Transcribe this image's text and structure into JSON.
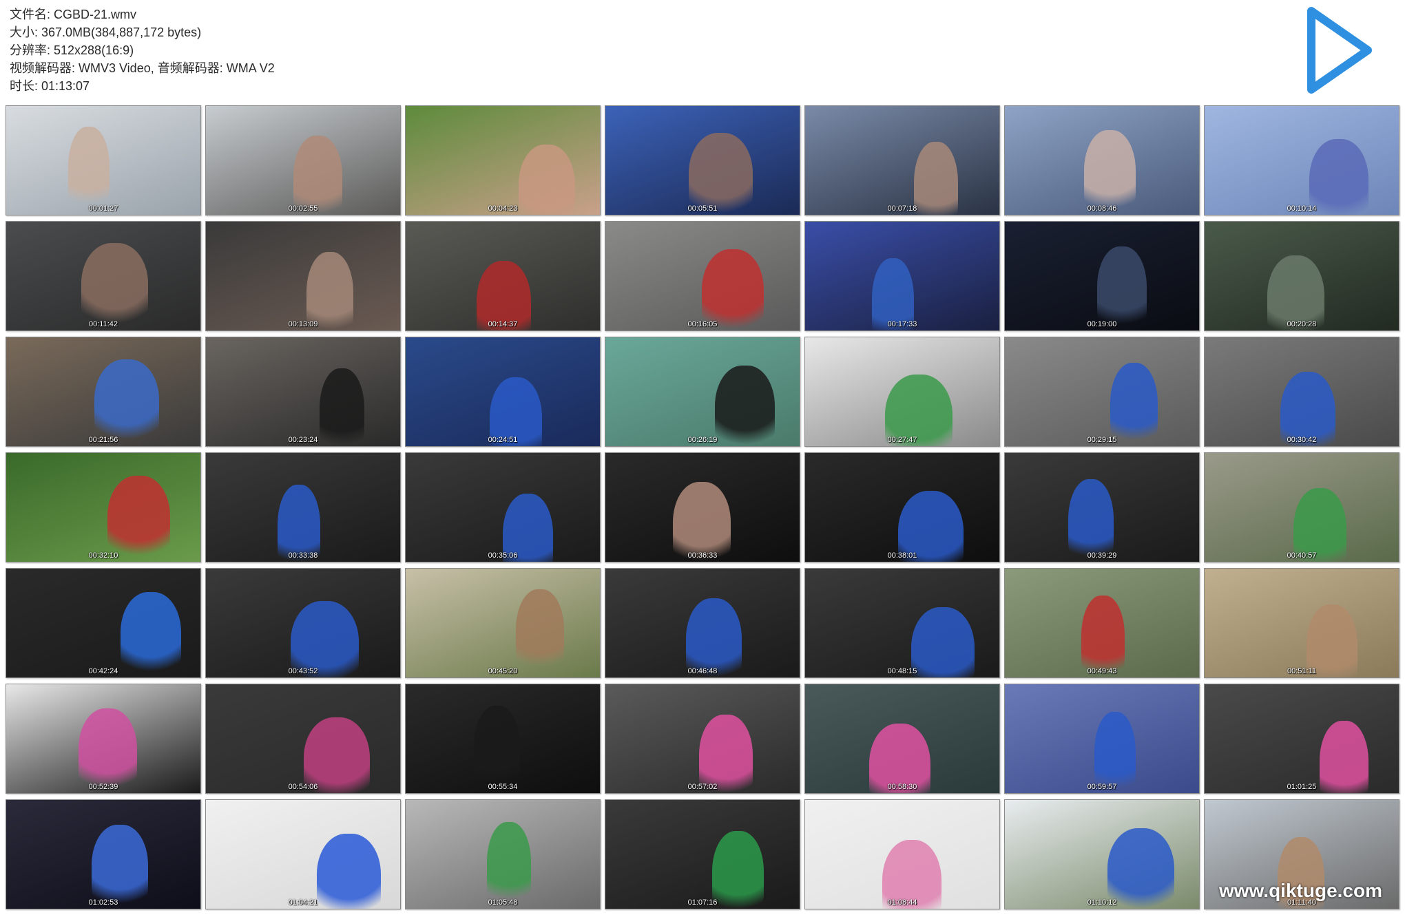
{
  "metadata": {
    "lines": [
      "文件名: CGBD-21.wmv",
      "大小: 367.0MB(384,887,172 bytes)",
      "分辨率: 512x288(16:9)",
      "视频解码器: WMV3 Video, 音频解码器: WMA V2",
      "时长: 01:13:07"
    ]
  },
  "icons": {
    "play": "play-icon",
    "play_color": "#2f8fe0"
  },
  "thumbnails": [
    {
      "ts": "00:01:27",
      "bg": [
        "#d8dce0",
        "#9aa3ab"
      ],
      "fig": "#c9b0a0"
    },
    {
      "ts": "00:02:55",
      "bg": [
        "#c7ccd0",
        "#5b5a58"
      ],
      "fig": "#b08a78"
    },
    {
      "ts": "00:04:23",
      "bg": [
        "#5d8b3c",
        "#c9a08a"
      ],
      "fig": "#c89880"
    },
    {
      "ts": "00:05:51",
      "bg": [
        "#3c62b8",
        "#1b2a55"
      ],
      "fig": "#8a6a60"
    },
    {
      "ts": "00:07:18",
      "bg": [
        "#7a8aa8",
        "#2a3344"
      ],
      "fig": "#a8897a"
    },
    {
      "ts": "00:08:46",
      "bg": [
        "#8ea3c6",
        "#4a5a7a"
      ],
      "fig": "#c8b0a8"
    },
    {
      "ts": "00:10:14",
      "bg": [
        "#9fb6e0",
        "#6d86b8"
      ],
      "fig": "#5a6ab8"
    },
    {
      "ts": "00:11:42",
      "bg": [
        "#4a4c4e",
        "#2a2a2a"
      ],
      "fig": "#8a6d60"
    },
    {
      "ts": "00:13:09",
      "bg": [
        "#3a3a3a",
        "#6a5a52"
      ],
      "fig": "#a48878"
    },
    {
      "ts": "00:14:37",
      "bg": [
        "#5a5a55",
        "#2e2e2c"
      ],
      "fig": "#b02a2a"
    },
    {
      "ts": "00:16:05",
      "bg": [
        "#8a8a88",
        "#5a5a5a"
      ],
      "fig": "#c03030"
    },
    {
      "ts": "00:17:33",
      "bg": [
        "#3a4ea8",
        "#1a2040"
      ],
      "fig": "#3060c0"
    },
    {
      "ts": "00:19:00",
      "bg": [
        "#1a2032",
        "#0a0c12"
      ],
      "fig": "#3a4a6a"
    },
    {
      "ts": "00:20:28",
      "bg": [
        "#4a5a4a",
        "#222a22"
      ],
      "fig": "#6a7a6a"
    },
    {
      "ts": "00:21:56",
      "bg": [
        "#7a6a5a",
        "#3a3a3a"
      ],
      "fig": "#3a6ac8"
    },
    {
      "ts": "00:23:24",
      "bg": [
        "#6a6560",
        "#2a2a2a"
      ],
      "fig": "#1a1a1a"
    },
    {
      "ts": "00:24:51",
      "bg": [
        "#2a4a8a",
        "#1a2a5a"
      ],
      "fig": "#2a5ac8"
    },
    {
      "ts": "00:26:19",
      "bg": [
        "#6aa89a",
        "#4a7a6a"
      ],
      "fig": "#1a1a1a"
    },
    {
      "ts": "00:27:47",
      "bg": [
        "#e8e8e8",
        "#8a8a8a"
      ],
      "fig": "#3a9a4a"
    },
    {
      "ts": "00:29:15",
      "bg": [
        "#8a8a8a",
        "#5a5a5a"
      ],
      "fig": "#2a5ac8"
    },
    {
      "ts": "00:30:42",
      "bg": [
        "#7a7a7a",
        "#4a4a4a"
      ],
      "fig": "#2a5ac8"
    },
    {
      "ts": "00:32:10",
      "bg": [
        "#3a6a2a",
        "#6a9a4a"
      ],
      "fig": "#c03030"
    },
    {
      "ts": "00:33:38",
      "bg": [
        "#3a3a3a",
        "#1a1a1a"
      ],
      "fig": "#2a5ac8"
    },
    {
      "ts": "00:35:06",
      "bg": [
        "#3a3a3a",
        "#1a1a1a"
      ],
      "fig": "#2a5ac8"
    },
    {
      "ts": "00:36:33",
      "bg": [
        "#2a2a2a",
        "#0e0e0e"
      ],
      "fig": "#b08a7a"
    },
    {
      "ts": "00:38:01",
      "bg": [
        "#2a2a2a",
        "#0e0e0e"
      ],
      "fig": "#2a5ac8"
    },
    {
      "ts": "00:39:29",
      "bg": [
        "#3a3a3a",
        "#1a1a1a"
      ],
      "fig": "#2a5ac8"
    },
    {
      "ts": "00:40:57",
      "bg": [
        "#9a9a8a",
        "#5a6a4a"
      ],
      "fig": "#3a9a4a"
    },
    {
      "ts": "00:42:24",
      "bg": [
        "#2a2a2a",
        "#1a1a1a"
      ],
      "fig": "#2a6ad8"
    },
    {
      "ts": "00:43:52",
      "bg": [
        "#3a3a3a",
        "#1a1a1a"
      ],
      "fig": "#2a5ac8"
    },
    {
      "ts": "00:45:20",
      "bg": [
        "#c8c0a8",
        "#6a7a4a"
      ],
      "fig": "#a07a5a"
    },
    {
      "ts": "00:46:48",
      "bg": [
        "#3a3a3a",
        "#1a1a1a"
      ],
      "fig": "#2a5ac8"
    },
    {
      "ts": "00:48:15",
      "bg": [
        "#3a3a3a",
        "#1a1a1a"
      ],
      "fig": "#2a5ac8"
    },
    {
      "ts": "00:49:43",
      "bg": [
        "#8a9a7a",
        "#5a6a4a"
      ],
      "fig": "#c03030"
    },
    {
      "ts": "00:51:11",
      "bg": [
        "#c0b090",
        "#8a7a5a"
      ],
      "fig": "#b08a6a"
    },
    {
      "ts": "00:52:39",
      "bg": [
        "#e8e8e8",
        "#1a1a1a"
      ],
      "fig": "#d050a0"
    },
    {
      "ts": "00:54:06",
      "bg": [
        "#3a3a3a",
        "#2a2a2a"
      ],
      "fig": "#c04080"
    },
    {
      "ts": "00:55:34",
      "bg": [
        "#2a2a2a",
        "#0e0e0e"
      ],
      "fig": "#1a1a1a"
    },
    {
      "ts": "00:57:02",
      "bg": [
        "#5a5a5a",
        "#2a2a2a"
      ],
      "fig": "#e050a0"
    },
    {
      "ts": "00:58:30",
      "bg": [
        "#4a5a5a",
        "#2a3a3a"
      ],
      "fig": "#e050a0"
    },
    {
      "ts": "00:59:57",
      "bg": [
        "#6a7ab8",
        "#3a4a8a"
      ],
      "fig": "#2a5ac8"
    },
    {
      "ts": "01:01:25",
      "bg": [
        "#4a4a4a",
        "#2a2a2a"
      ],
      "fig": "#e050a0"
    },
    {
      "ts": "01:02:53",
      "bg": [
        "#2a2a3a",
        "#0e0e1a"
      ],
      "fig": "#3a6ad8"
    },
    {
      "ts": "01:04:21",
      "bg": [
        "#f0f0f0",
        "#d8d8d8"
      ],
      "fig": "#2a5ad8"
    },
    {
      "ts": "01:05:48",
      "bg": [
        "#b8b8b8",
        "#6a6a6a"
      ],
      "fig": "#3a9a4a"
    },
    {
      "ts": "01:07:16",
      "bg": [
        "#3a3a3a",
        "#1a1a1a"
      ],
      "fig": "#2a9a4a"
    },
    {
      "ts": "01:08:44",
      "bg": [
        "#f0f0f0",
        "#e0e0e0"
      ],
      "fig": "#e080b0"
    },
    {
      "ts": "01:10:12",
      "bg": [
        "#e8ecef",
        "#7a8a6a"
      ],
      "fig": "#2a5ac8"
    },
    {
      "ts": "01:11:40",
      "bg": [
        "#c0c8d0",
        "#6a6a6a"
      ],
      "fig": "#b08a6a",
      "watermark": "www.qiktuge.com"
    }
  ]
}
